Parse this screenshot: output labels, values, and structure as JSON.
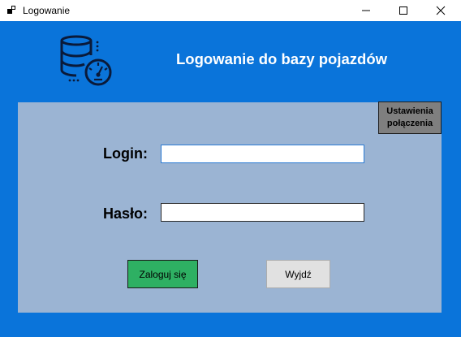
{
  "window": {
    "title": "Logowanie",
    "controls": {
      "minimize": "minimize-icon",
      "maximize": "maximize-icon",
      "close": "close-icon"
    }
  },
  "header": {
    "title": "Logowanie do bazy pojazdów",
    "logo_icon": "database-gauge-icon"
  },
  "settings_button": {
    "line1": "Ustawienia",
    "line2": "połączenia"
  },
  "form": {
    "login_label": "Login:",
    "login_value": "",
    "password_label": "Hasło:",
    "password_value": ""
  },
  "actions": {
    "login_label": "Zaloguj się",
    "exit_label": "Wyjdź"
  },
  "colors": {
    "background": "#0a74da",
    "panel": "#9bb4d3",
    "login_button": "#2eb063",
    "settings_button": "#7f7f7f"
  }
}
